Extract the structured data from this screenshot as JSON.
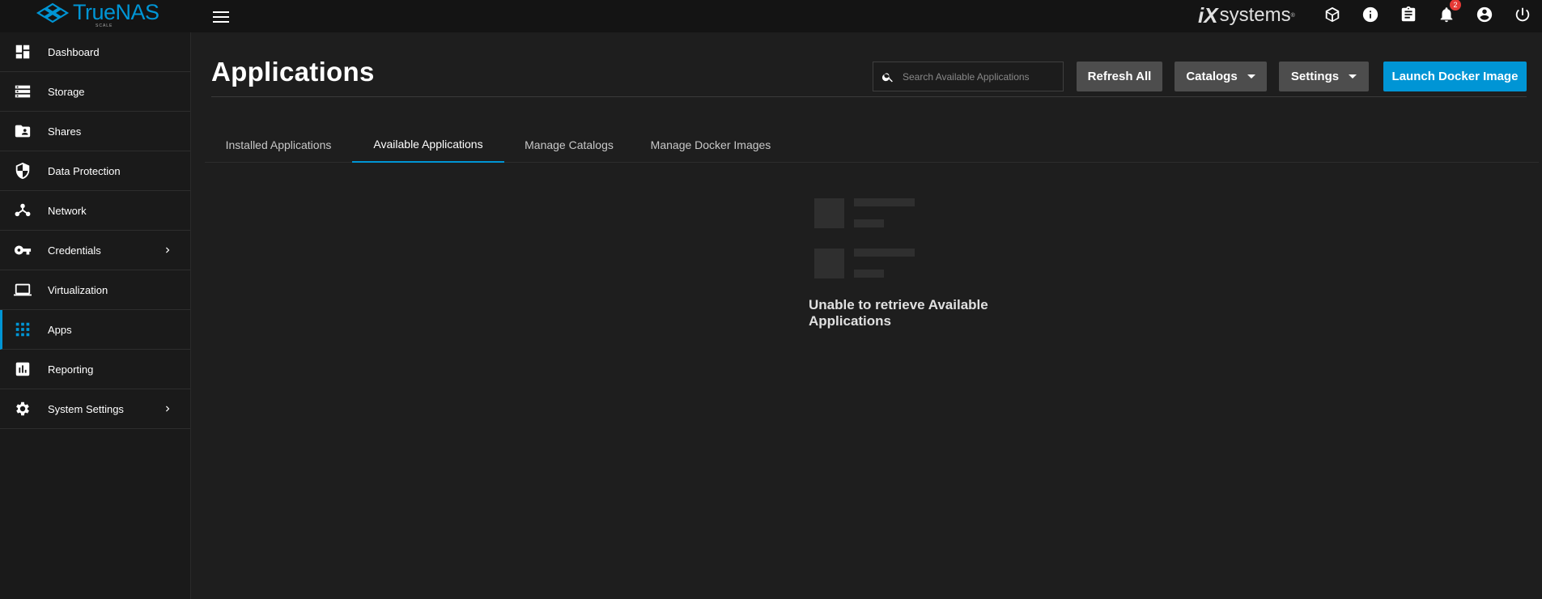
{
  "topbar": {
    "brand_name": "TrueNAS",
    "brand_sub": "SCALE",
    "vendor_logo_i": "iX",
    "vendor_logo_text": "systems",
    "vendor_tm": "®",
    "notification_count": "2",
    "icons": [
      "menu-icon",
      "truecommand-icon",
      "info-icon",
      "clipboard-icon",
      "bell-icon",
      "account-icon",
      "power-icon"
    ]
  },
  "sidebar": {
    "items": [
      {
        "label": "Dashboard",
        "icon": "dashboard-icon"
      },
      {
        "label": "Storage",
        "icon": "storage-icon"
      },
      {
        "label": "Shares",
        "icon": "folder-shared-icon"
      },
      {
        "label": "Data Protection",
        "icon": "shield-icon"
      },
      {
        "label": "Network",
        "icon": "network-icon"
      },
      {
        "label": "Credentials",
        "icon": "key-icon"
      },
      {
        "label": "Virtualization",
        "icon": "laptop-icon"
      },
      {
        "label": "Apps",
        "icon": "apps-grid-icon"
      },
      {
        "label": "Reporting",
        "icon": "chart-icon"
      },
      {
        "label": "System Settings",
        "icon": "gear-icon"
      }
    ]
  },
  "main": {
    "title": "Applications",
    "search_placeholder": "Search Available Applications",
    "buttons": {
      "refresh": "Refresh All",
      "catalogs": "Catalogs",
      "settings": "Settings",
      "launch": "Launch Docker Image"
    },
    "tabs": [
      {
        "label": "Installed Applications"
      },
      {
        "label": "Available Applications"
      },
      {
        "label": "Manage Catalogs"
      },
      {
        "label": "Manage Docker Images"
      }
    ],
    "active_tab": "Available Applications",
    "empty_message": "Unable to retrieve Available Applications"
  },
  "colors": {
    "accent": "#0095d5",
    "topbar_bg": "#141414",
    "sidebar_bg": "#1a1a1a",
    "main_bg": "#1e1e1e",
    "button_bg": "#4d4d4d",
    "badge": "#e53935"
  }
}
